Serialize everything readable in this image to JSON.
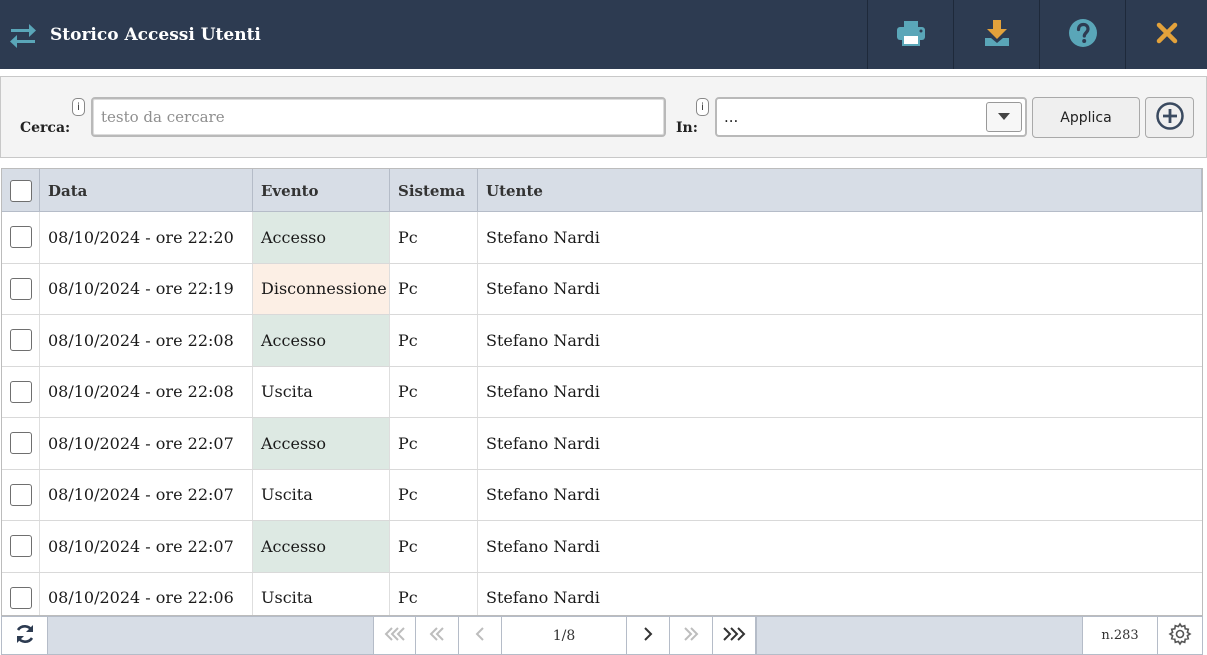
{
  "header": {
    "title": "Storico Accessi Utenti",
    "app_icon": "swap-arrows-icon",
    "tools": [
      {
        "name": "print-icon"
      },
      {
        "name": "download-icon"
      },
      {
        "name": "help-icon"
      },
      {
        "name": "close-icon"
      }
    ],
    "colors": {
      "bar": "#2d3b51",
      "icon_teal": "#5aa6b8",
      "icon_orange": "#e3a23b"
    }
  },
  "filter": {
    "search_label": "Cerca:",
    "search_info": "i",
    "search_placeholder": "testo da cercare",
    "search_value": "",
    "in_label": "In:",
    "in_info": "i",
    "in_value": "...",
    "apply_label": "Applica"
  },
  "table": {
    "columns": [
      "Data",
      "Evento",
      "Sistema",
      "Utente"
    ],
    "rows": [
      {
        "data": "08/10/2024 - ore 22:20",
        "evento": "Accesso",
        "sistema": "Pc",
        "utente": "Stefano Nardi"
      },
      {
        "data": "08/10/2024 - ore 22:19",
        "evento": "Disconnessione",
        "sistema": "Pc",
        "utente": "Stefano Nardi"
      },
      {
        "data": "08/10/2024 - ore 22:08",
        "evento": "Accesso",
        "sistema": "Pc",
        "utente": "Stefano Nardi"
      },
      {
        "data": "08/10/2024 - ore 22:08",
        "evento": "Uscita",
        "sistema": "Pc",
        "utente": "Stefano Nardi"
      },
      {
        "data": "08/10/2024 - ore 22:07",
        "evento": "Accesso",
        "sistema": "Pc",
        "utente": "Stefano Nardi"
      },
      {
        "data": "08/10/2024 - ore 22:07",
        "evento": "Uscita",
        "sistema": "Pc",
        "utente": "Stefano Nardi"
      },
      {
        "data": "08/10/2024 - ore 22:07",
        "evento": "Accesso",
        "sistema": "Pc",
        "utente": "Stefano Nardi"
      },
      {
        "data": "08/10/2024 - ore 22:06",
        "evento": "Uscita",
        "sistema": "Pc",
        "utente": "Stefano Nardi"
      }
    ],
    "event_colors": {
      "Accesso": "#dde9e3",
      "Disconnessione": "#fcefe5"
    }
  },
  "pager": {
    "page_info": "1/8",
    "count": "n.283",
    "refresh_icon": "refresh-icon",
    "settings_icon": "gear-icon"
  }
}
